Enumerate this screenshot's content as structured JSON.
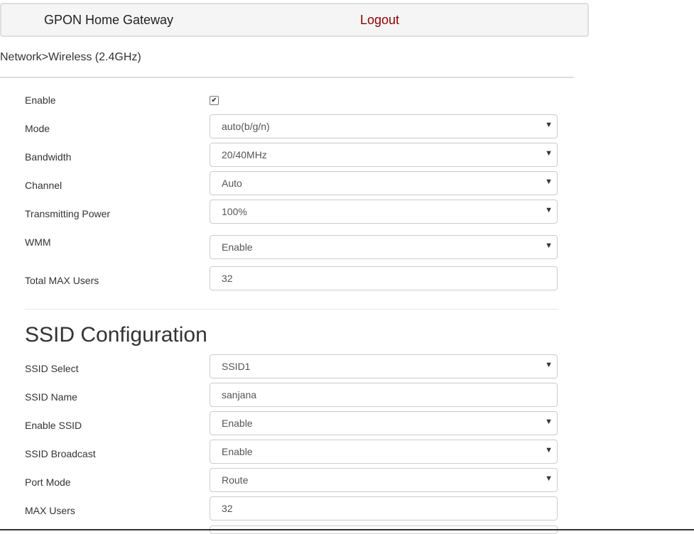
{
  "header": {
    "brand": "GPON Home Gateway",
    "logout": "Logout"
  },
  "breadcrumb": "Network>Wireless (2.4GHz)",
  "wireless": {
    "enable": {
      "label": "Enable",
      "checked": true
    },
    "mode": {
      "label": "Mode",
      "value": "auto(b/g/n)"
    },
    "bandwidth": {
      "label": "Bandwidth",
      "value": "20/40MHz"
    },
    "channel": {
      "label": "Channel",
      "value": "Auto"
    },
    "tx_power": {
      "label": "Transmitting Power",
      "value": "100%"
    },
    "wmm": {
      "label": "WMM",
      "value": "Enable"
    },
    "total_max_users": {
      "label": "Total MAX Users",
      "value": "32"
    }
  },
  "ssid": {
    "title": "SSID Configuration",
    "select": {
      "label": "SSID Select",
      "value": "SSID1"
    },
    "name": {
      "label": "SSID Name",
      "value": "sanjana"
    },
    "enable": {
      "label": "Enable SSID",
      "value": "Enable"
    },
    "broadcast": {
      "label": "SSID Broadcast",
      "value": "Enable"
    },
    "port_mode": {
      "label": "Port Mode",
      "value": "Route"
    },
    "max_users": {
      "label": "MAX Users",
      "value": "32"
    }
  },
  "icons": {
    "caret": "▼",
    "check": "✔"
  }
}
